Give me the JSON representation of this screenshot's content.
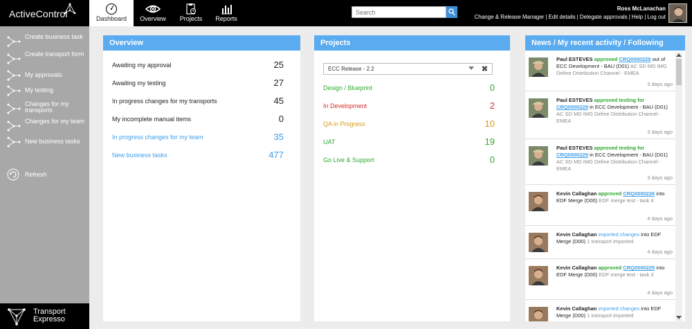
{
  "app": {
    "brand": "ActiveControl",
    "footer_line1": "Transport",
    "footer_line2": "Expresso"
  },
  "nav": {
    "tabs": [
      {
        "label": "Dashboard",
        "icon": "gauge-icon",
        "active": true
      },
      {
        "label": "Overview",
        "icon": "eye-icon",
        "active": false
      },
      {
        "label": "Projects",
        "icon": "clipboard-icon",
        "active": false
      },
      {
        "label": "Reports",
        "icon": "bar-chart-icon",
        "active": false
      }
    ]
  },
  "search": {
    "placeholder": "Search",
    "button_icon": "search-icon"
  },
  "user": {
    "name": "Ross McLanachan",
    "links": [
      "Change & Release Manager",
      "Edit details",
      "Delegate approvals",
      "Help",
      "Log out"
    ]
  },
  "sidebar": {
    "items": [
      {
        "label": "Create business task",
        "icon": "workflow-icon"
      },
      {
        "label": "Create transport form",
        "icon": "workflow-icon"
      },
      {
        "label": "My approvals",
        "icon": "workflow-icon"
      },
      {
        "label": "My testing",
        "icon": "workflow-icon"
      },
      {
        "label": "Changes for my transports",
        "icon": "workflow-icon"
      },
      {
        "label": "Changes for my team",
        "icon": "workflow-icon"
      },
      {
        "label": "New business tasks",
        "icon": "workflow-icon"
      }
    ],
    "refresh_label": "Refresh"
  },
  "overview": {
    "title": "Overview",
    "rows": [
      {
        "label": "Awaiting my approval",
        "count": "25",
        "color": "#222222"
      },
      {
        "label": "Awaiting my testing",
        "count": "27",
        "color": "#222222"
      },
      {
        "label": "In progress changes for my transports",
        "count": "45",
        "color": "#222222"
      },
      {
        "label": "My incomplete manual items",
        "count": "0",
        "color": "#222222"
      },
      {
        "label": "In progress changes for my team",
        "count": "35",
        "color": "#3f9ee8"
      },
      {
        "label": "New business tasks",
        "count": "477",
        "color": "#3f9ee8"
      }
    ]
  },
  "projects": {
    "title": "Projects",
    "selected": "ECC Release - 2.2",
    "rows": [
      {
        "label": "Design / Blueprint",
        "count": "0",
        "color": "#2ea82e"
      },
      {
        "label": "In Development",
        "count": "2",
        "color": "#d0302a"
      },
      {
        "label": "QA in Progress",
        "count": "10",
        "color": "#d79a16"
      },
      {
        "label": "UAT",
        "count": "19",
        "color": "#2ea82e"
      },
      {
        "label": "Go Live & Support",
        "count": "0",
        "color": "#2ea82e"
      }
    ]
  },
  "news": {
    "title": "News / My recent activity / Following",
    "items": [
      {
        "actor": "Paul ESTEVES",
        "verb": "approved",
        "verb_type": "green",
        "link": "CRQ0000229",
        "mid": "out of ECC Development - BAU (D01)",
        "detail": "AC SD MD IMG Define Distribution Channel - EMEA",
        "time": "3 days ago"
      },
      {
        "actor": "Paul ESTEVES",
        "verb": "approved testing for",
        "verb_type": "green",
        "link": "CRQ0000229",
        "mid": "in ECC Development - BAU (D01)",
        "detail": "AC SD MD IMG Define Distribution Channel - EMEA",
        "time": "3 days ago"
      },
      {
        "actor": "Paul ESTEVES",
        "verb": "approved testing for",
        "verb_type": "green",
        "link": "CRQ0000229",
        "mid": "in ECC Development - BAU (D01)",
        "detail": "AC SD MD IMG Define Distribution Channel - EMEA",
        "time": "3 days ago"
      },
      {
        "actor": "Kevin Callaghan",
        "verb": "approved",
        "verb_type": "green",
        "link": "CRQ0000226",
        "mid": "into EDF Merge (D00)",
        "detail": "EDF merge test - task 4",
        "time": "4 days ago"
      },
      {
        "actor": "Kevin Callaghan",
        "verb": "imported changes",
        "verb_type": "blue",
        "link": "",
        "mid": "into EDF Merge (D00)",
        "detail": "1 transport imported",
        "time": "4 days ago"
      },
      {
        "actor": "Kevin Callaghan",
        "verb": "approved",
        "verb_type": "green",
        "link": "CRQ0000225",
        "mid": "into EDF Merge (D00)",
        "detail": "EDF merge test - task 3",
        "time": "4 days ago"
      },
      {
        "actor": "Kevin Callaghan",
        "verb": "imported changes",
        "verb_type": "blue",
        "link": "",
        "mid": "into EDF Merge (D00)",
        "detail": "1 transport imported",
        "time": "4 days ago"
      }
    ]
  }
}
